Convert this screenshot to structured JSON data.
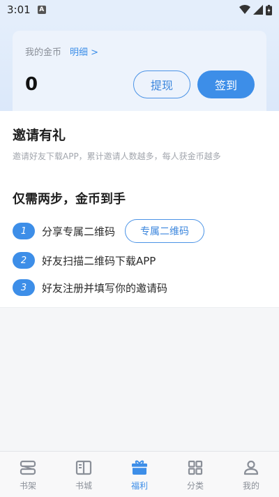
{
  "status_bar": {
    "time": "3:01",
    "notif_letter": "A"
  },
  "coins": {
    "label": "我的金币",
    "detail_link": "明细 >",
    "count": "0",
    "withdraw_label": "提现",
    "signin_label": "签到"
  },
  "invite": {
    "title": "邀请有礼",
    "description": "邀请好友下载APP，累计邀请人数越多，每人获金币越多"
  },
  "steps": {
    "title": "仅需两步，金币到手",
    "items": [
      {
        "num": "1",
        "text": "分享专属二维码"
      },
      {
        "num": "2",
        "text": "好友扫描二维码下载APP"
      },
      {
        "num": "3",
        "text": "好友注册并填写你的邀请码"
      }
    ],
    "qr_button_label": "专属二维码"
  },
  "nav": {
    "items": [
      {
        "label": "书架",
        "icon": "bookshelf-icon"
      },
      {
        "label": "书城",
        "icon": "open-book-icon"
      },
      {
        "label": "福利",
        "icon": "gift-icon"
      },
      {
        "label": "分类",
        "icon": "grid-icon"
      },
      {
        "label": "我的",
        "icon": "person-icon"
      }
    ],
    "active_index": 2
  },
  "colors": {
    "accent": "#3d8ee8",
    "inactive": "#8a8f98"
  }
}
